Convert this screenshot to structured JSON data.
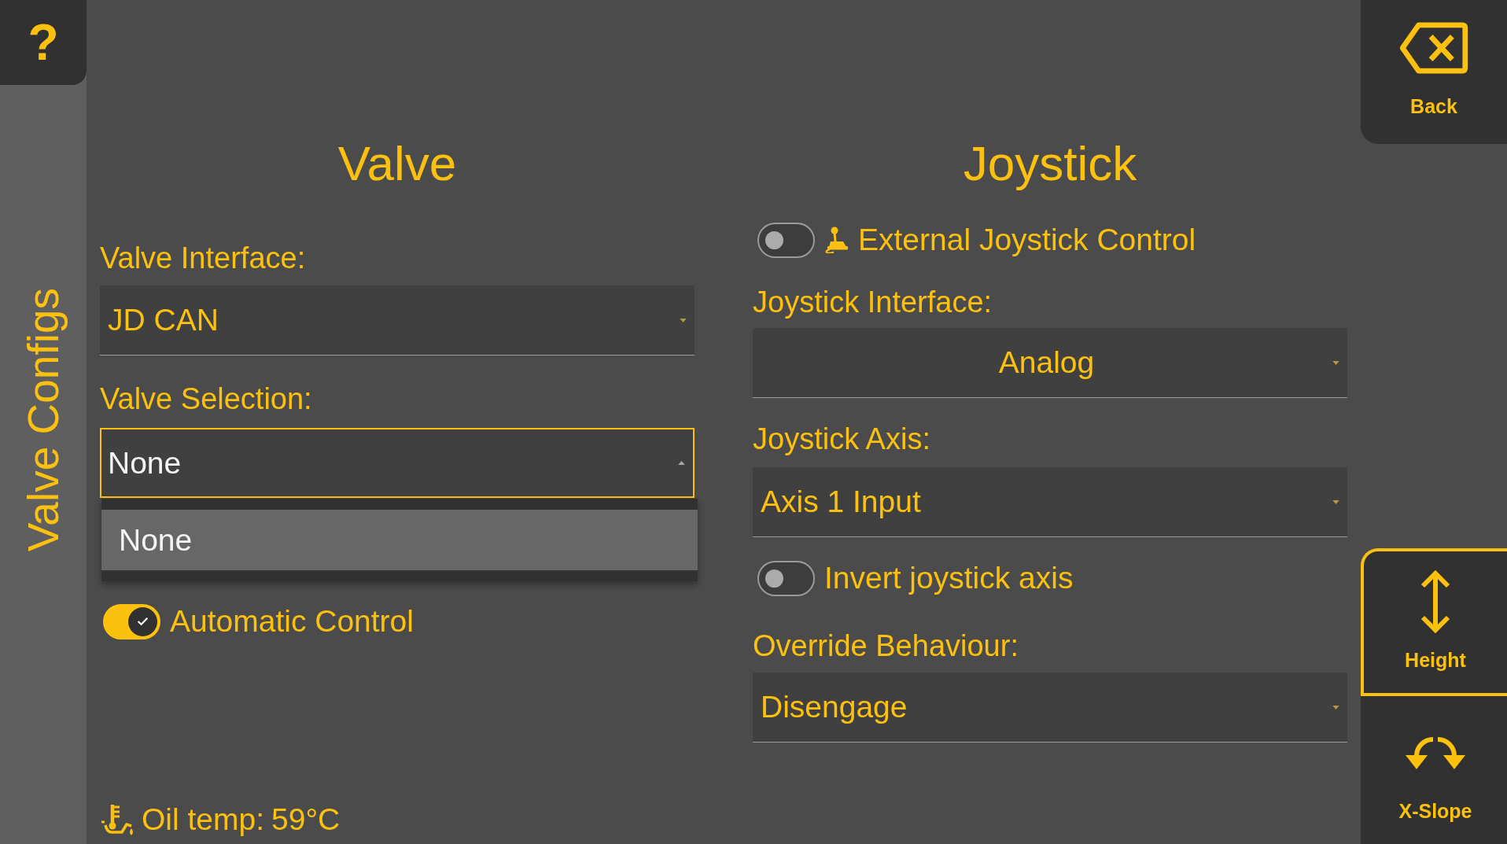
{
  "help_button": {
    "symbol": "?"
  },
  "sidebar": {
    "title": "Valve Configs"
  },
  "valve": {
    "title": "Valve",
    "interface": {
      "label": "Valve Interface:",
      "value": "JD CAN",
      "expanded": false
    },
    "selection": {
      "label": "Valve Selection:",
      "value": "None",
      "expanded": true,
      "options": [
        {
          "label": "None",
          "selected": true
        }
      ]
    },
    "automatic_control": {
      "label": "Automatic Control",
      "on": true
    }
  },
  "joystick": {
    "title": "Joystick",
    "external_control": {
      "label": "External Joystick Control",
      "on": false
    },
    "interface": {
      "label": "Joystick Interface:",
      "value": "Analog",
      "expanded": false
    },
    "axis": {
      "label": "Joystick Axis:",
      "value": "Axis 1 Input",
      "expanded": false
    },
    "invert_axis": {
      "label": "Invert joystick axis",
      "on": false
    },
    "override_behaviour": {
      "label": "Override Behaviour:",
      "value": "Disengage",
      "expanded": false
    }
  },
  "oil_temp": {
    "label": "Oil temp:",
    "value": "59°C"
  },
  "back_button": {
    "label": "Back"
  },
  "modes": [
    {
      "kind": "height",
      "label": "Height",
      "selected": true
    },
    {
      "kind": "slope",
      "label": "X-Slope",
      "selected": false
    }
  ]
}
